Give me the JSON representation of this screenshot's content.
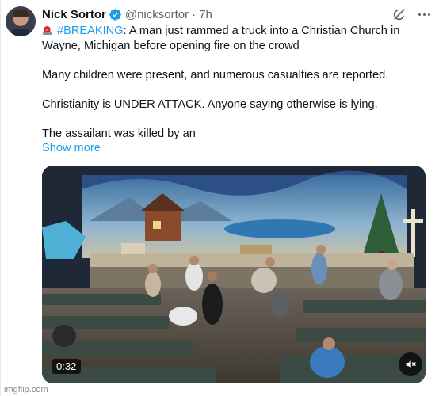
{
  "tweet": {
    "author_name": "Nick Sortor",
    "handle": "@nicksortor",
    "separator": "·",
    "time": "7h",
    "hashtag": "#BREAKING",
    "line1_rest": ": A man just rammed a truck into a Christian Church in Wayne, Michigan before opening fire on the crowd",
    "para2": "Many children were present, and numerous casualties are reported.",
    "para3": "Christianity is UNDER ATTACK. Anyone saying otherwise is lying.",
    "para4": "The assailant was killed by an",
    "show_more": "Show more"
  },
  "media": {
    "duration": "0:32"
  },
  "watermark": "imgflip.com",
  "icons": {
    "verified": "verified-badge-icon",
    "siren": "rotating-light-icon",
    "grok": "grok-icon",
    "more": "more-horizontal-icon",
    "mute": "speaker-muted-icon"
  },
  "colors": {
    "accent": "#1d9bf0",
    "text": "#0f1419",
    "muted": "#536471"
  }
}
